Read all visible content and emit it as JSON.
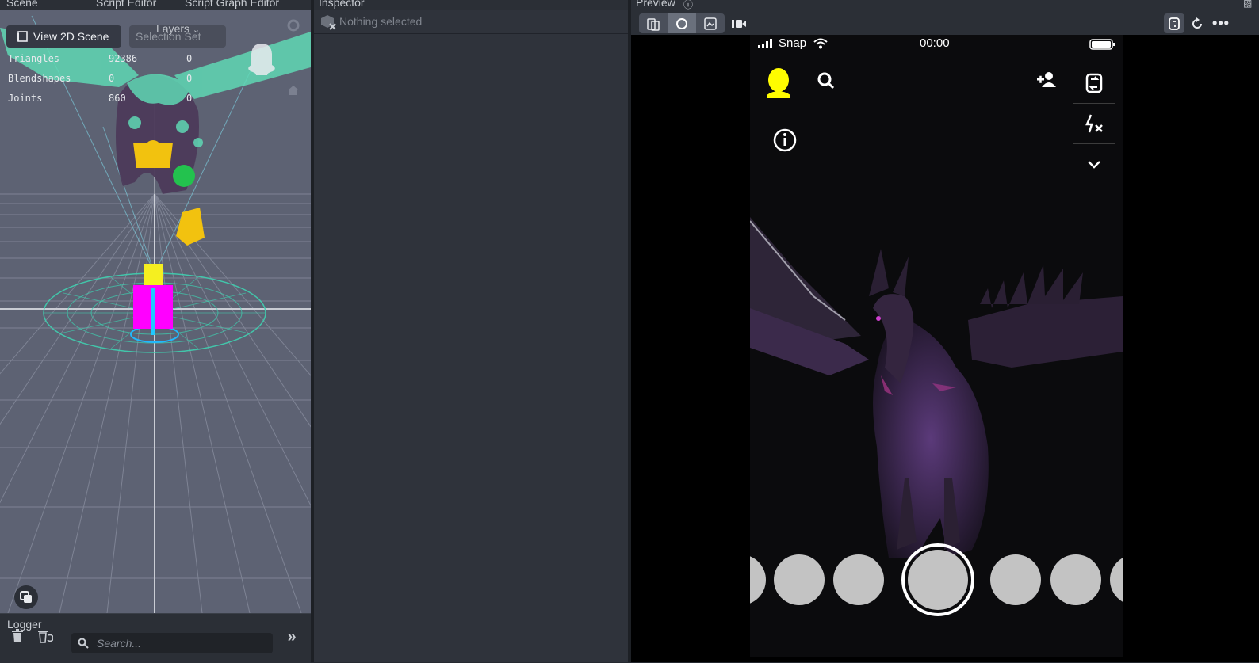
{
  "tabs": {
    "scene": "Scene",
    "script_editor": "Script Editor",
    "script_graph_editor": "Script Graph Editor",
    "inspector": "Inspector",
    "preview": "Preview"
  },
  "scene": {
    "view2d_label": "View 2D Scene",
    "selection_set_label": "Selection Set",
    "layers_label": "Layers",
    "stats": [
      {
        "name": "Triangles",
        "value": "92386",
        "extra": "0"
      },
      {
        "name": "Blendshapes",
        "value": "0",
        "extra": "0"
      },
      {
        "name": "Joints",
        "value": "860",
        "extra": "0"
      }
    ]
  },
  "logger": {
    "title": "Logger",
    "search_placeholder": "Search..."
  },
  "inspector": {
    "empty_text": "Nothing selected"
  },
  "phone": {
    "carrier": "Snap",
    "time": "00:00"
  },
  "colors": {
    "panel_bg": "#2f333b",
    "viewport_bg": "#5d6273",
    "accent_teal": "#5fd8b4",
    "snap_yellow": "#fffc00",
    "phone_bg": "#0b0b0d"
  }
}
